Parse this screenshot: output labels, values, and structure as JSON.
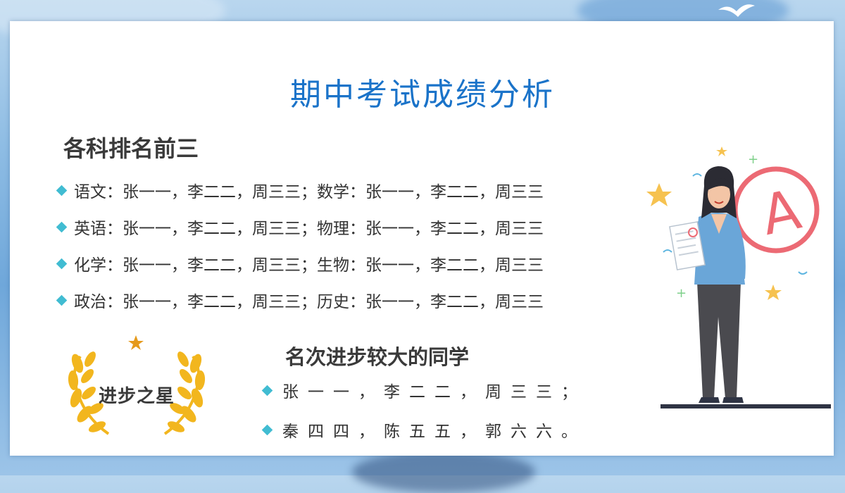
{
  "slide_title": "期中考试成绩分析",
  "section_top3": {
    "heading": "各科排名前三",
    "items": [
      "语文：张一一，李二二，周三三；数学：张一一，李二二，周三三",
      "英语：张一一，李二二，周三三；物理：张一一，李二二，周三三",
      "化学：张一一，李二二，周三三；生物：张一一，李二二，周三三",
      "政治：张一一，李二二，周三三；历史：张一一，李二二，周三三"
    ]
  },
  "section_progress": {
    "heading": "名次进步较大的同学",
    "items": [
      "张一一，李二二，周三三；",
      "秦四四，陈五五，郭六六。"
    ]
  },
  "badge": {
    "label": "进步之星"
  },
  "illustration": {
    "grade_mark": "A"
  },
  "colors": {
    "title": "#1a73c9",
    "heading": "#3a3a3a",
    "bullet": "#41bcd2",
    "laurel": "#f2b61e",
    "grade_circle": "#ec6a74",
    "background": "#8fbde4"
  },
  "icons": [
    "diamond-bullet-icon",
    "laurel-wreath-icon",
    "star-icon",
    "teacher-illustration"
  ]
}
